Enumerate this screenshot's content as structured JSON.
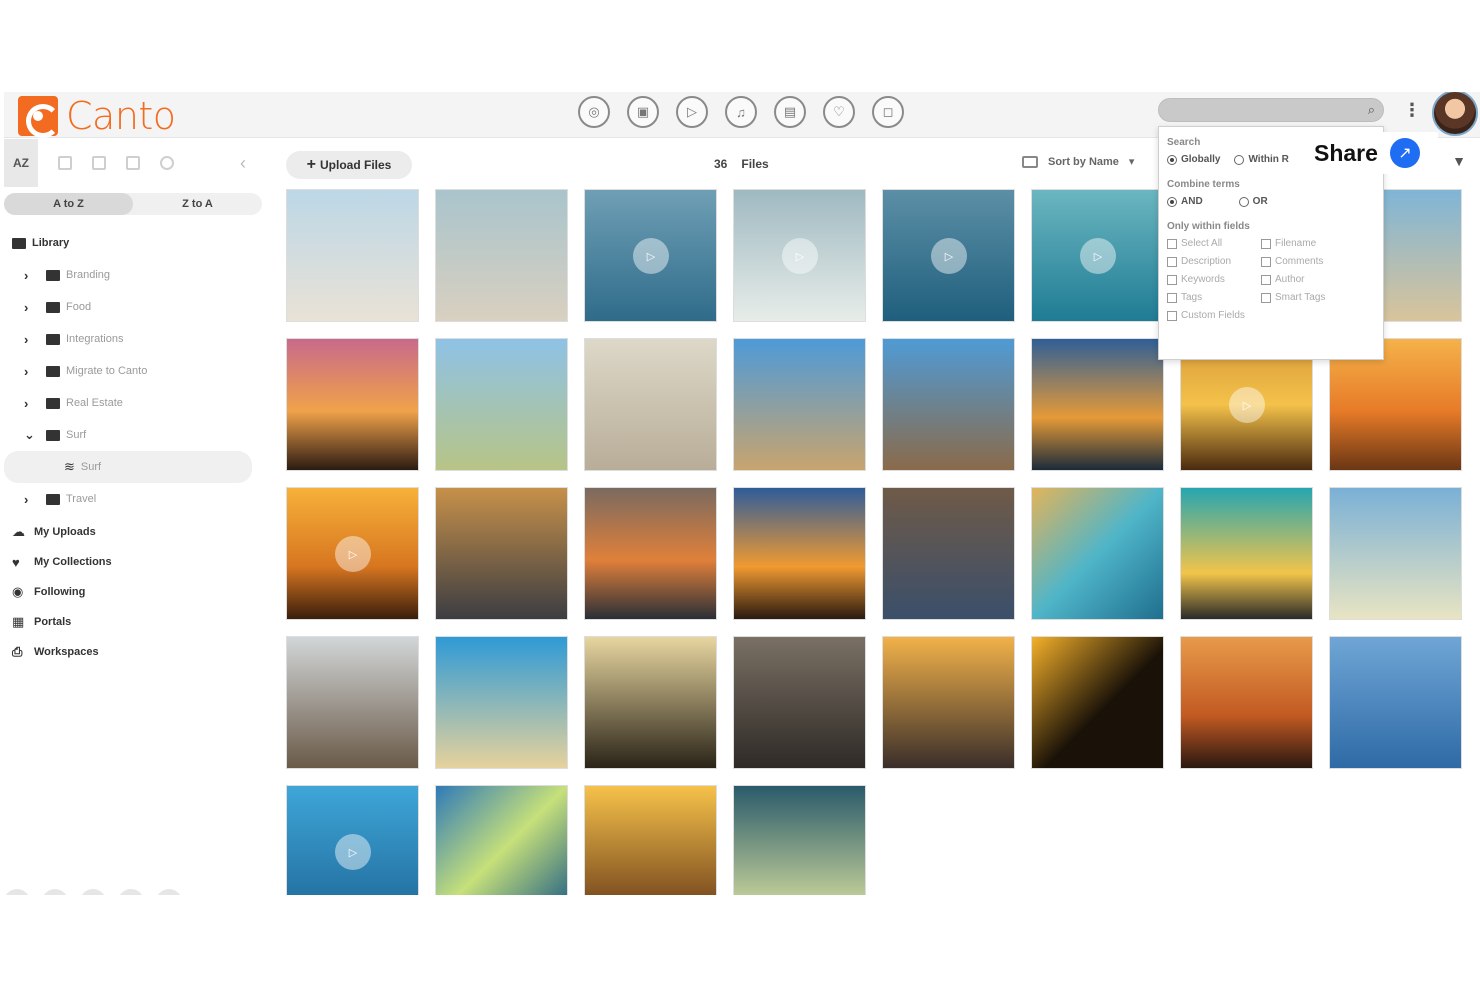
{
  "app": {
    "name": "Canto"
  },
  "topbar": {
    "type_icons": [
      "all-icon",
      "image-icon",
      "video-icon",
      "audio-icon",
      "document-icon",
      "presentation-icon",
      "other-icon"
    ],
    "type_glyphs": [
      "◎",
      "▣",
      "▷",
      "♫",
      "▤",
      "♡",
      "◻"
    ]
  },
  "sidebar": {
    "sort_az": "AZ",
    "sort_options": [
      "A to Z",
      "Z to A"
    ],
    "library_label": "Library",
    "folders": [
      "Branding",
      "Food",
      "Integrations",
      "Migrate to Canto",
      "Real Estate",
      "Surf",
      "Travel"
    ],
    "sub_album": "Surf",
    "nav": [
      {
        "icon": "cloud-upload-icon",
        "glyph": "☁",
        "label": "My Uploads"
      },
      {
        "icon": "heart-icon",
        "glyph": "♥",
        "label": "My Collections"
      },
      {
        "icon": "eye-icon",
        "glyph": "◉",
        "label": "Following"
      },
      {
        "icon": "grid-icon",
        "glyph": "▦",
        "label": "Portals"
      },
      {
        "icon": "workspace-icon",
        "glyph": "⎙",
        "label": "Workspaces"
      }
    ]
  },
  "main": {
    "upload_label": "Upload Files",
    "file_count": "36",
    "files_label": "Files",
    "sort_label": "Sort by Name"
  },
  "search_panel": {
    "search_heading": "Search",
    "search_options": [
      "Globally",
      "Within R"
    ],
    "combine_heading": "Combine terms",
    "combine_options": [
      "AND",
      "OR"
    ],
    "fields_heading": "Only within fields",
    "fields": [
      "Select All",
      "Filename",
      "Description",
      "Comments",
      "Keywords",
      "Author",
      "Tags",
      "Smart Tags",
      "Custom Fields"
    ]
  },
  "share": {
    "label": "Share"
  },
  "colors": {
    "brand": "#f26b21",
    "share_blue": "#1f6df2"
  }
}
